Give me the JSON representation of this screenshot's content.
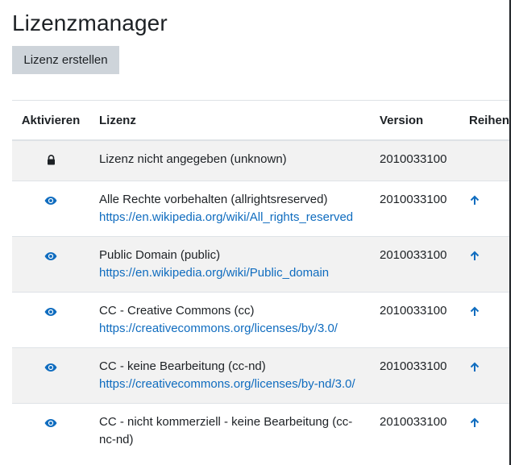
{
  "page": {
    "title": "Lizenzmanager",
    "create_button": "Lizenz erstellen"
  },
  "table": {
    "headers": {
      "activate": "Aktivieren",
      "license": "Lizenz",
      "version": "Version",
      "order": "Reihenfolge"
    },
    "rows": [
      {
        "status_icon": "lock-icon",
        "name": "Lizenz nicht angegeben (unknown)",
        "url": "",
        "version": "2010033100",
        "order_icon": ""
      },
      {
        "status_icon": "eye-icon",
        "name": "Alle Rechte vorbehalten (allrightsreserved)",
        "url": "https://en.wikipedia.org/wiki/All_rights_reserved",
        "version": "2010033100",
        "order_icon": "arrow-up-icon"
      },
      {
        "status_icon": "eye-icon",
        "name": "Public Domain (public)",
        "url": "https://en.wikipedia.org/wiki/Public_domain",
        "version": "2010033100",
        "order_icon": "arrow-up-icon"
      },
      {
        "status_icon": "eye-icon",
        "name": "CC - Creative Commons (cc)",
        "url": "https://creativecommons.org/licenses/by/3.0/",
        "version": "2010033100",
        "order_icon": "arrow-up-icon"
      },
      {
        "status_icon": "eye-icon",
        "name": "CC - keine Bearbeitung (cc-nd)",
        "url": "https://creativecommons.org/licenses/by-nd/3.0/",
        "version": "2010033100",
        "order_icon": "arrow-up-icon"
      },
      {
        "status_icon": "eye-icon",
        "name": "CC - nicht kommerziell - keine Bearbeitung (cc-nc-nd)",
        "url": "",
        "version": "2010033100",
        "order_icon": "arrow-up-icon"
      }
    ]
  },
  "colors": {
    "link": "#0f6cbf",
    "button_bg": "#ced4da",
    "stripe": "#f2f2f2"
  }
}
